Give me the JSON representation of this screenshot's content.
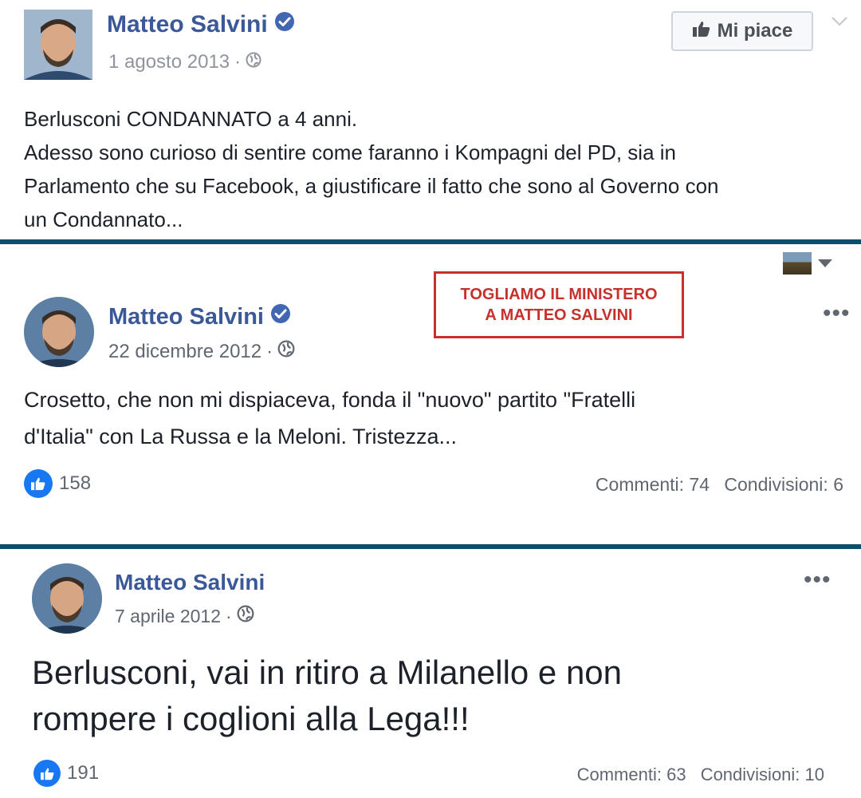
{
  "posts": [
    {
      "author": "Matteo Salvini",
      "date": "1 agosto 2013",
      "separator": "·",
      "like_button": "Mi piace",
      "lines": [
        "Berlusconi CONDANNATO a 4 anni.",
        "Adesso sono curioso di sentire come faranno i Kompagni del PD, sia in",
        "Parlamento che su Facebook, a giustificare il fatto che sono al Governo con",
        "un Condannato..."
      ]
    },
    {
      "author": "Matteo Salvini",
      "date": "22 dicembre 2012",
      "separator": "·",
      "banner": [
        "TOGLIAMO IL MINISTERO",
        "A MATTEO SALVINI"
      ],
      "lines": [
        "Crosetto, che non mi dispiaceva, fonda il \"nuovo\" partito \"Fratelli",
        "d'Italia\" con La Russa e la Meloni. Tristezza..."
      ],
      "likes": "158",
      "comments": "Commenti: 74",
      "shares": "Condivisioni: 6"
    },
    {
      "author": "Matteo Salvini",
      "date": "7 aprile 2012",
      "separator": "·",
      "lines": [
        "Berlusconi, vai in ritiro a Milanello e non",
        "rompere i coglioni alla Lega!!!"
      ],
      "likes": "191",
      "comments": "Commenti: 63",
      "shares": "Condivisioni: 10"
    }
  ],
  "icons": {
    "verified": "verified-badge-icon",
    "globe": "globe-icon",
    "thumb": "thumbs-up-icon",
    "more": "more-options-icon"
  },
  "colors": {
    "author": "#3b5998",
    "verified": "#4267b2",
    "like_badge": "#1877f2",
    "divider": "#0f4d6e",
    "banner_red": "#c8302b"
  }
}
